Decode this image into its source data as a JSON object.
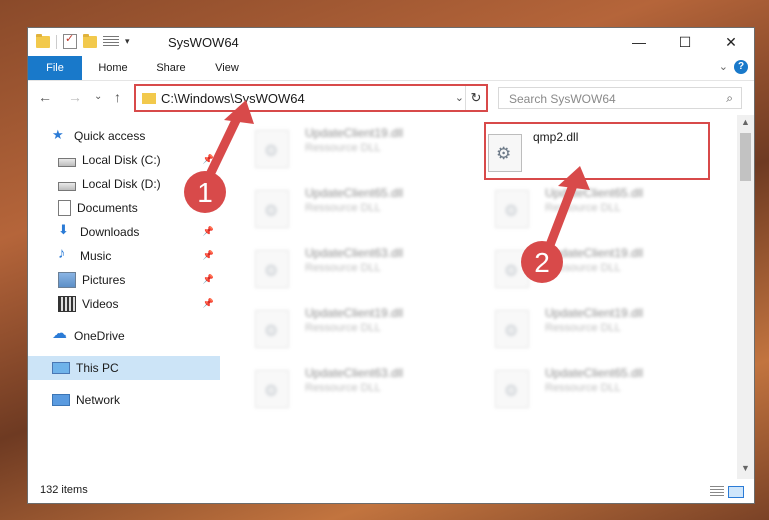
{
  "window": {
    "title": "SysWOW64",
    "controls": {
      "minimize": "—",
      "maximize": "☐",
      "close": "✕"
    }
  },
  "ribbon": {
    "tabs": [
      "File",
      "Home",
      "Share",
      "View"
    ],
    "help": "?"
  },
  "navigation": {
    "address": "C:\\Windows\\SysWOW64",
    "search_placeholder": "Search SysWOW64"
  },
  "sidebar": {
    "items": [
      {
        "label": "Quick access",
        "icon": "star-icon",
        "pinned": false
      },
      {
        "label": "Local Disk (C:)",
        "icon": "drive-icon",
        "pinned": true
      },
      {
        "label": "Local Disk (D:)",
        "icon": "drive-icon",
        "pinned": true
      },
      {
        "label": "Documents",
        "icon": "documents-icon",
        "pinned": true
      },
      {
        "label": "Downloads",
        "icon": "download-icon",
        "pinned": true
      },
      {
        "label": "Music",
        "icon": "music-icon",
        "pinned": true
      },
      {
        "label": "Pictures",
        "icon": "pictures-icon",
        "pinned": true
      },
      {
        "label": "Videos",
        "icon": "videos-icon",
        "pinned": true
      },
      {
        "label": "OneDrive",
        "icon": "cloud-icon",
        "pinned": false
      },
      {
        "label": "This PC",
        "icon": "computer-icon",
        "pinned": false,
        "selected": true
      },
      {
        "label": "Network",
        "icon": "network-icon",
        "pinned": false
      }
    ]
  },
  "files": {
    "left_column": [
      {
        "name": "UpdateClient19.dll",
        "type": "Ressource DLL"
      },
      {
        "name": "UpdateClient65.dll",
        "type": "Ressource DLL"
      },
      {
        "name": "UpdateClient63.dll",
        "type": "Ressource DLL"
      },
      {
        "name": "UpdateClient19.dll",
        "type": "Ressource DLL"
      },
      {
        "name": "UpdateClient63.dll",
        "type": "Ressource DLL"
      }
    ],
    "right_column": [
      {
        "name": "UpdateClient65.dll",
        "type": "Ressource DLL"
      },
      {
        "name": "UpdateClient19.dll",
        "type": "Ressource DLL"
      },
      {
        "name": "UpdateClient19.dll",
        "type": "Ressource DLL"
      },
      {
        "name": "UpdateClient65.dll",
        "type": "Ressource DLL"
      }
    ],
    "highlighted": {
      "name": "qmp2.dll"
    }
  },
  "status": {
    "item_count": "132 items"
  },
  "annotations": {
    "step1": "1",
    "step2": "2",
    "color": "#d84a4a"
  }
}
